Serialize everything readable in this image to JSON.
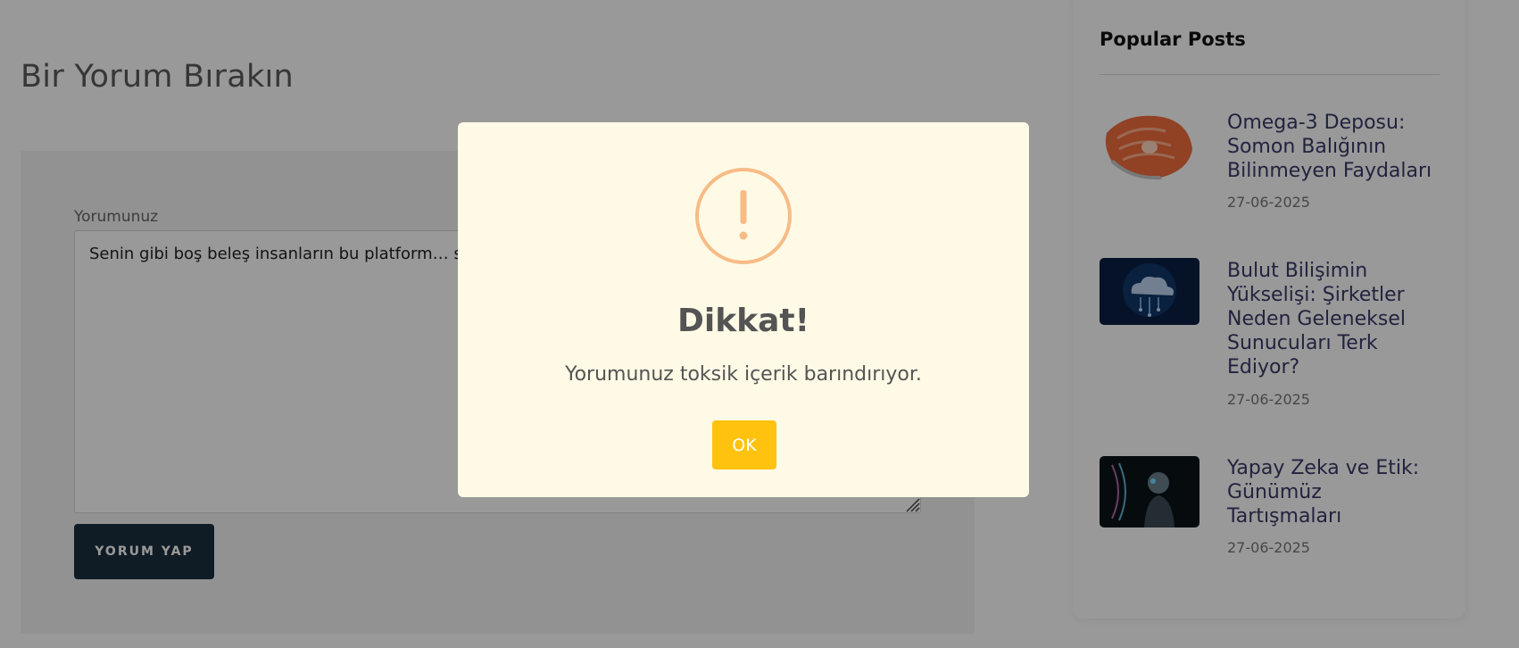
{
  "comment_section": {
    "heading": "Bir Yorum Bırakın",
    "field_label": "Yorumunuz",
    "comment_text": "Senin gibi boş beleş insanların bu platform… sadece ortamı kirletiyorsun. Yazdığın her ş…",
    "submit_label": "YORUM YAP"
  },
  "sidebar": {
    "title": "Popular Posts",
    "posts": [
      {
        "title": "Omega-3 Deposu: Somon Balığının Bilinmeyen Faydaları",
        "date": "27-06-2025",
        "thumb": "salmon-image"
      },
      {
        "title": "Bulut Bilişimin Yükselişi: Şirketler Neden Geleneksel Sunucuları Terk Ediyor?",
        "date": "27-06-2025",
        "thumb": "cloud-computing-image"
      },
      {
        "title": "Yapay Zeka ve Etik: Günümüz Tartışmaları",
        "date": "27-06-2025",
        "thumb": "ai-robot-image"
      }
    ]
  },
  "modal": {
    "icon": "warning-icon",
    "title": "Dikkat!",
    "message": "Yorumunuz toksik içerik barındırıyor.",
    "ok_label": "OK"
  },
  "colors": {
    "overlay": "rgba(0,0,0,0.4)",
    "modal_bg": "#fffae6",
    "warning": "#f8bb86",
    "ok_button": "#ffc20e",
    "submit_button": "#1c2f3e"
  }
}
